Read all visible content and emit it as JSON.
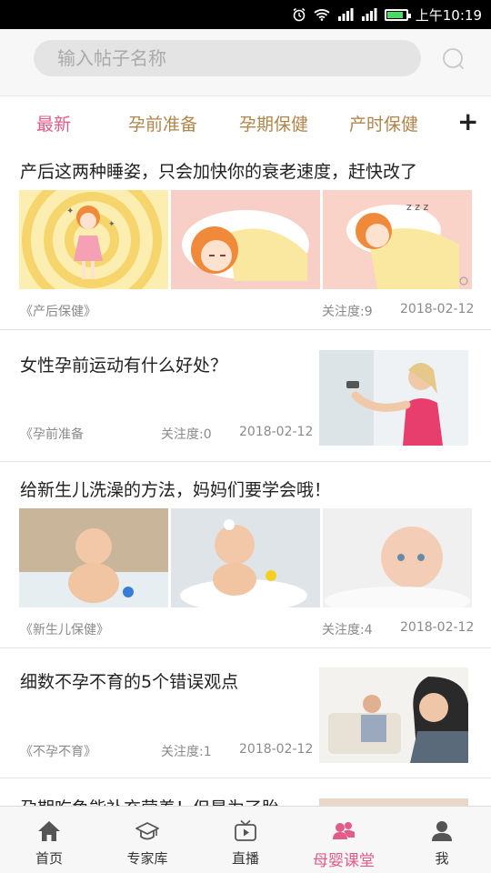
{
  "status_bar": {
    "time": "上午10:19"
  },
  "search": {
    "placeholder": "输入帖子名称"
  },
  "tabs": [
    {
      "label": "最新",
      "active": true
    },
    {
      "label": "孕前准备",
      "active": false
    },
    {
      "label": "孕期保健",
      "active": false
    },
    {
      "label": "产时保健",
      "active": false
    }
  ],
  "tab_more_label": "+",
  "articles": [
    {
      "title": "产后这两种睡姿，只会加快你的衰老速度，赶快改了",
      "category": "《产后保健》",
      "attention": "关注度:9",
      "date": "2018-02-12"
    },
    {
      "title": "女性孕前运动有什么好处？",
      "category": "《孕前准备",
      "attention": "关注度:0",
      "date": "2018-02-12"
    },
    {
      "title": "给新生儿洗澡的方法，妈妈们要学会哦！",
      "category": "《新生儿保健》",
      "attention": "关注度:4",
      "date": "2018-02-12"
    },
    {
      "title": "细数不孕不育的5个错误观点",
      "category": "《不孕不育》",
      "attention": "关注度:1",
      "date": "2018-02-12"
    },
    {
      "title": "孕期吃鱼能补充营养！但是为了胎",
      "category": "",
      "attention": "",
      "date": ""
    }
  ],
  "bottom_nav": [
    {
      "label": "首页",
      "icon": "home-icon"
    },
    {
      "label": "专家库",
      "icon": "graduation-cap-icon"
    },
    {
      "label": "直播",
      "icon": "tv-play-icon"
    },
    {
      "label": "母婴课堂",
      "icon": "group-icon",
      "active": true
    },
    {
      "label": "我",
      "icon": "person-icon"
    }
  ],
  "colors": {
    "accent": "#e35b87",
    "tab_text": "#b0854c",
    "meta_text": "#8a8a8a"
  }
}
